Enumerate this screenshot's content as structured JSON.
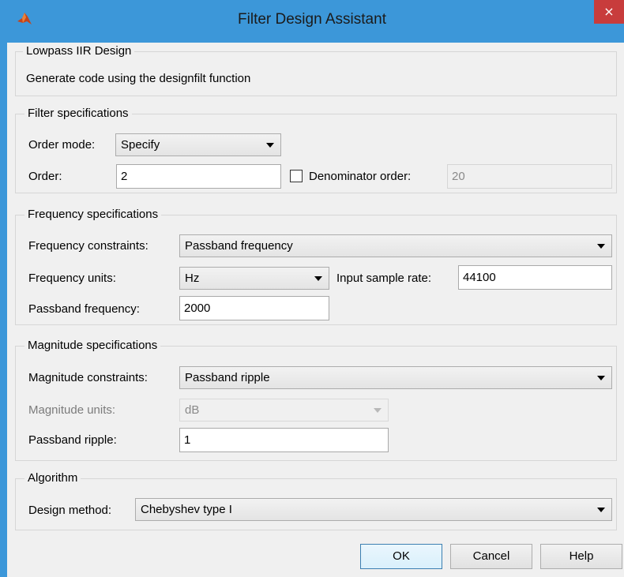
{
  "window": {
    "title": "Filter Design Assistant",
    "close_label": "×"
  },
  "header": {
    "group_title": "Lowpass IIR Design",
    "description": "Generate code using the designfilt function"
  },
  "filter_spec": {
    "title": "Filter specifications",
    "order_mode_label": "Order mode:",
    "order_mode_value": "Specify",
    "order_label": "Order:",
    "order_value": "2",
    "denominator_label": "Denominator order:",
    "denominator_value": "20",
    "denominator_checked": false
  },
  "frequency_spec": {
    "title": "Frequency specifications",
    "constraints_label": "Frequency constraints:",
    "constraints_value": "Passband frequency",
    "units_label": "Frequency units:",
    "units_value": "Hz",
    "sample_rate_label": "Input sample rate:",
    "sample_rate_value": "44100",
    "passband_label": "Passband frequency:",
    "passband_value": "2000"
  },
  "magnitude_spec": {
    "title": "Magnitude specifications",
    "constraints_label": "Magnitude constraints:",
    "constraints_value": "Passband ripple",
    "units_label": "Magnitude units:",
    "units_value": "dB",
    "ripple_label": "Passband ripple:",
    "ripple_value": "1"
  },
  "algorithm": {
    "title": "Algorithm",
    "method_label": "Design method:",
    "method_value": "Chebyshev type I"
  },
  "buttons": {
    "ok": "OK",
    "cancel": "Cancel",
    "help": "Help"
  }
}
